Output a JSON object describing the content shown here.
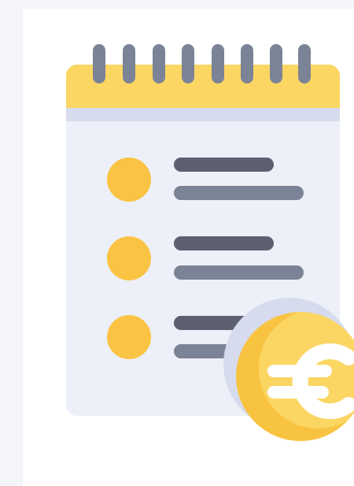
{
  "image": {
    "subject": "receipt-with-euro-icon",
    "colors": {
      "page_bg": "#f4f5f8",
      "card_bg": "#ffffff",
      "paper": "#edf0f8",
      "paper_band": "#d6dced",
      "header": "#fbd663",
      "rings": "#7b8396",
      "bullet": "#fbc343",
      "line_dark": "#5c6070",
      "line_light": "#7b8396",
      "coin_shadow": "#d6dced",
      "coin": "#f9c342",
      "coin_highlight": "#fbd663",
      "euro_symbol": "#ffffff"
    }
  }
}
